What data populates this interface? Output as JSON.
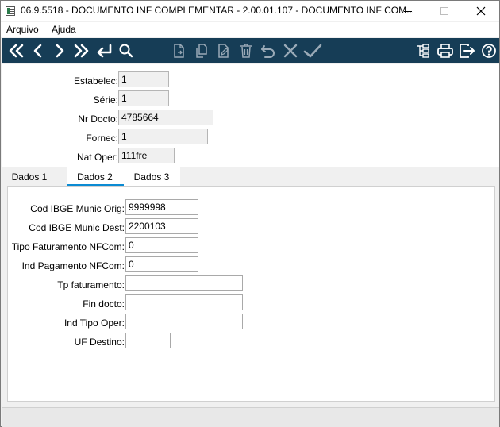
{
  "window": {
    "title": "06.9.5518 - DOCUMENTO INF COMPLEMENTAR - 2.00.01.107 - DOCUMENTO INF COM..."
  },
  "menu": [
    "Arquivo",
    "Ajuda"
  ],
  "toolbar": {
    "buttons": [
      "first-record",
      "previous-record",
      "next-record",
      "last-record",
      "goto-record",
      "search",
      "new-record",
      "copy-record",
      "edit-record",
      "delete-record",
      "undo",
      "cancel",
      "confirm",
      "tree-view",
      "print",
      "exit",
      "help"
    ],
    "background": "#163d56"
  },
  "header": {
    "fields": [
      {
        "label": "Estabelec:",
        "value": "1"
      },
      {
        "label": "Série:",
        "value": "1"
      },
      {
        "label": "Nr Docto:",
        "value": "4785664"
      },
      {
        "label": "Fornec:",
        "value": "1"
      },
      {
        "label": "Nat Oper:",
        "value": "111fre"
      }
    ]
  },
  "tabs": {
    "items": [
      "Dados 1",
      "Dados 2",
      "Dados 3"
    ],
    "active": "Dados 2",
    "accent": "#0b8bd3"
  },
  "dados2": {
    "fields": [
      {
        "label": "Cod IBGE Munic Orig:",
        "value": "9999998"
      },
      {
        "label": "Cod IBGE Munic Dest:",
        "value": "2200103"
      },
      {
        "label": "Tipo Faturamento NFCom:",
        "value": "0"
      },
      {
        "label": "Ind Pagamento NFCom:",
        "value": "0"
      },
      {
        "label": "Tp faturamento:",
        "value": ""
      },
      {
        "label": "Fin docto:",
        "value": ""
      },
      {
        "label": "Ind Tipo Oper:",
        "value": ""
      },
      {
        "label": "UF Destino:",
        "value": ""
      }
    ]
  }
}
